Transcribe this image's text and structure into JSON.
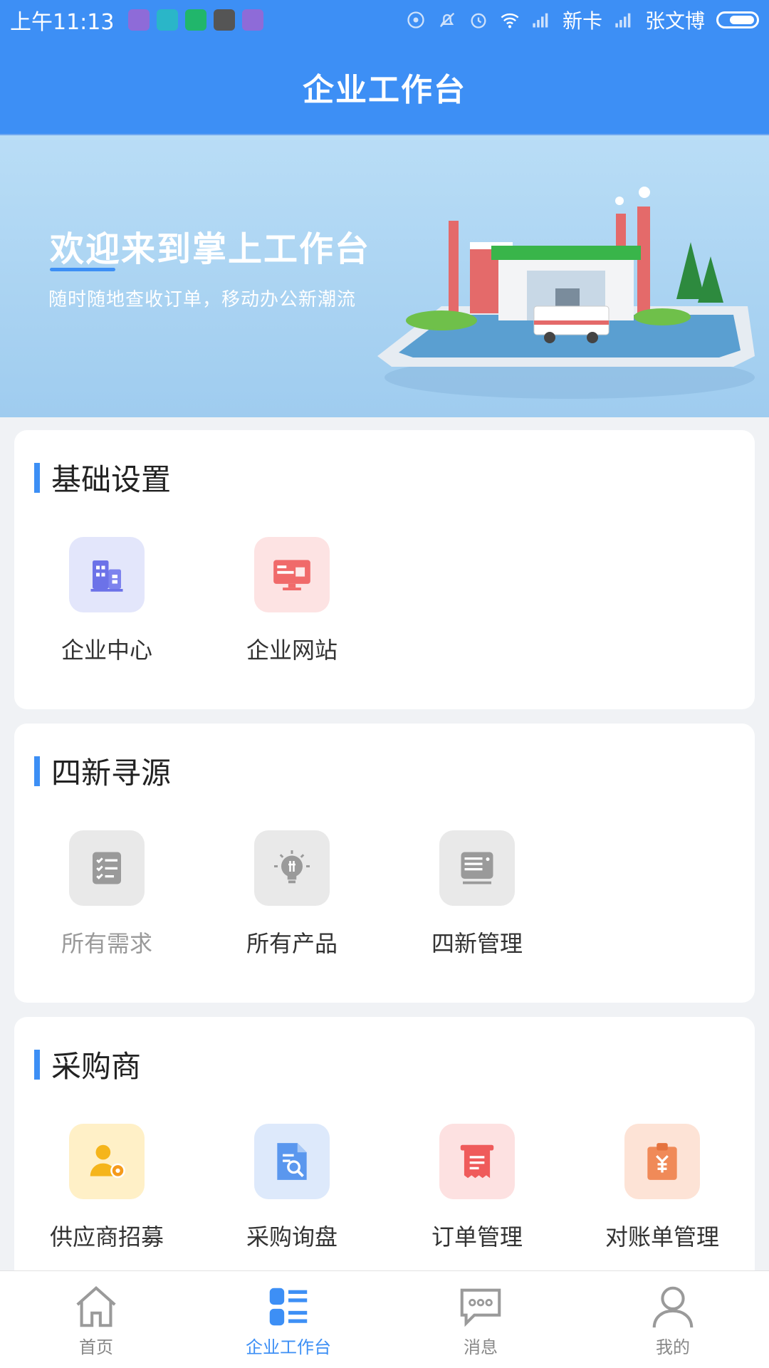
{
  "status_bar": {
    "time": "上午11:13",
    "carrier1": "新卡",
    "carrier2": "张文博"
  },
  "header": {
    "title": "企业工作台"
  },
  "banner": {
    "title": "欢迎来到掌上工作台",
    "subtitle": "随时随地查收订单，移动办公新潮流"
  },
  "sections": [
    {
      "title": "基础设置",
      "items": [
        {
          "label": "企业中心",
          "icon": "building-icon",
          "bg": "#e3e6fb",
          "color": "#6c72e8"
        },
        {
          "label": "企业网站",
          "icon": "website-monitor-icon",
          "bg": "#fde3e3",
          "color": "#f06a6a"
        }
      ]
    },
    {
      "title": "四新寻源",
      "items": [
        {
          "label": "所有需求",
          "icon": "checklist-icon",
          "bg": "#e9e9e9",
          "color": "#9a9a9a"
        },
        {
          "label": "所有产品",
          "icon": "lightbulb-icon",
          "bg": "#e9e9e9",
          "color": "#9a9a9a"
        },
        {
          "label": "四新管理",
          "icon": "server-icon",
          "bg": "#e9e9e9",
          "color": "#9a9a9a"
        }
      ]
    },
    {
      "title": "采购商",
      "items": [
        {
          "label": "供应商招募",
          "icon": "user-gear-icon",
          "bg": "#fff0c7",
          "color": "#f5b51b"
        },
        {
          "label": "采购询盘",
          "icon": "document-search-icon",
          "bg": "#dde9fb",
          "color": "#5a97ee"
        },
        {
          "label": "订单管理",
          "icon": "receipt-icon",
          "bg": "#fde1e1",
          "color": "#ef5b5b"
        },
        {
          "label": "对账单管理",
          "icon": "yen-clipboard-icon",
          "bg": "#fde3d6",
          "color": "#f08a58"
        }
      ]
    }
  ],
  "bottom_nav": [
    {
      "label": "首页",
      "icon": "home-icon"
    },
    {
      "label": "企业工作台",
      "icon": "workbench-icon",
      "active": true
    },
    {
      "label": "消息",
      "icon": "message-icon"
    },
    {
      "label": "我的",
      "icon": "user-icon"
    }
  ],
  "colors": {
    "primary": "#3d8ff5",
    "background": "#f0f2f5"
  }
}
